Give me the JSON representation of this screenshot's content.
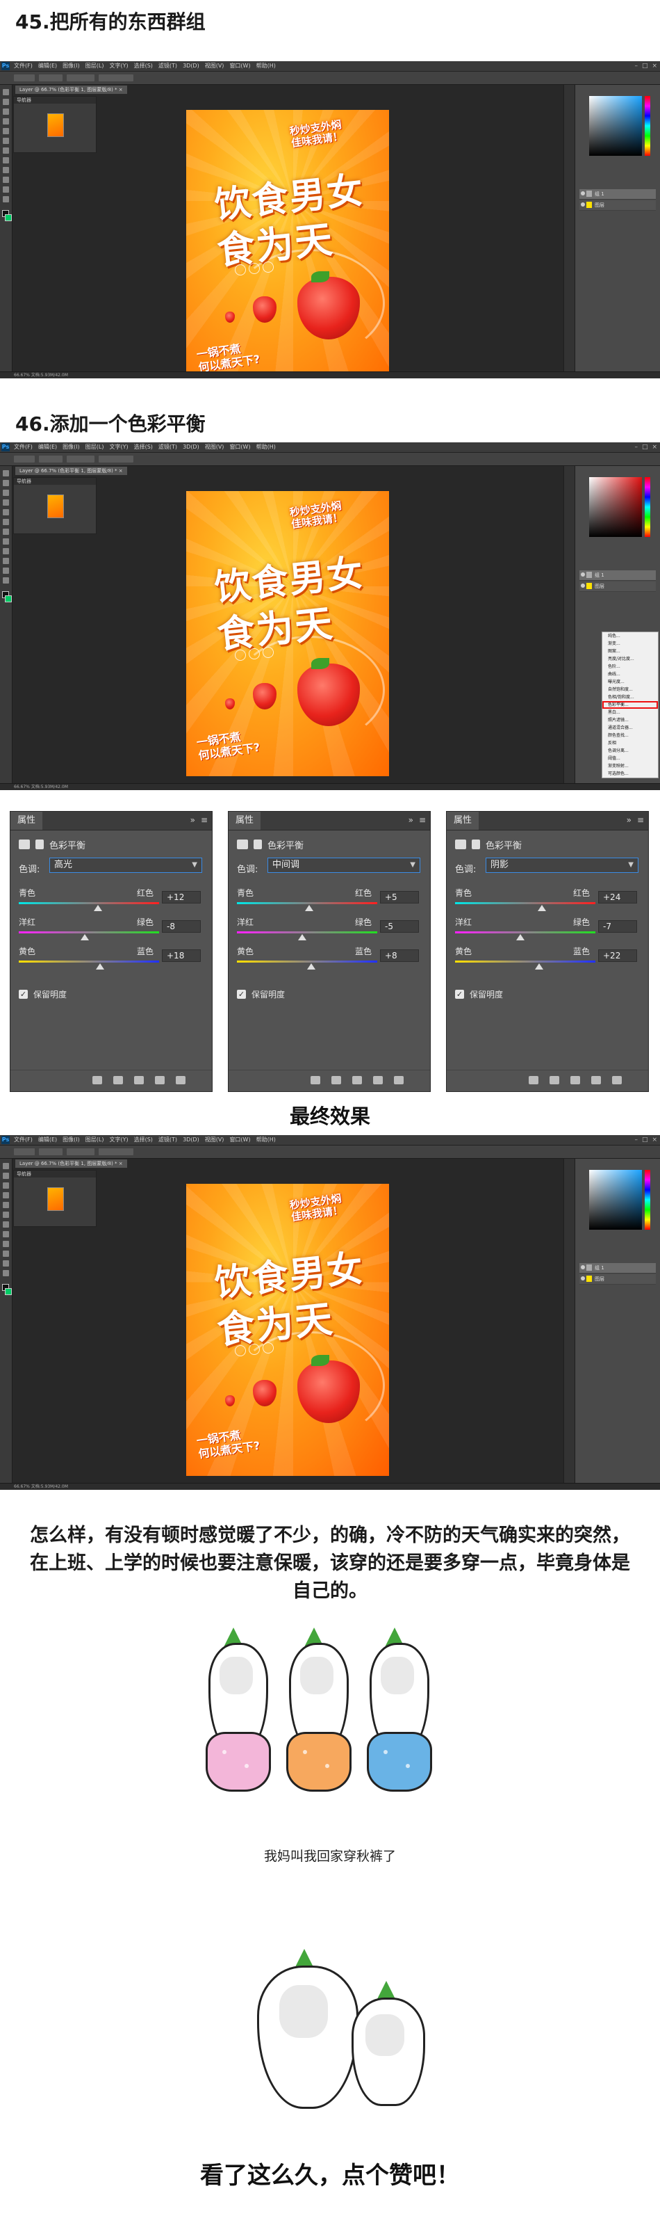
{
  "step45": {
    "title": "45.把所有的东西群组"
  },
  "step46": {
    "title": "46.添加一个色彩平衡"
  },
  "ps": {
    "menus": [
      "文件(F)",
      "编辑(E)",
      "图像(I)",
      "图层(L)",
      "文字(Y)",
      "选择(S)",
      "滤镜(T)",
      "3D(D)",
      "视图(V)",
      "窗口(W)",
      "帮助(H)"
    ],
    "doc_tab": "Layer @ 66.7% (色彩平衡 1, 图层蒙版/8) * ×",
    "nav_title": "导航器",
    "status_text": "66.67%   文档:5.93M/42.0M",
    "layers": [
      "组 1",
      "图层"
    ],
    "zoom": "66.67%"
  },
  "poster": {
    "tag_line1": "秒炒支外焖",
    "tag_line2": "佳味我请！",
    "title1": "饮食男女",
    "title2": "食为天",
    "bottom1": "一锅不煮",
    "bottom2": "何以煮天下?"
  },
  "context_menu": {
    "items": [
      "纯色...",
      "渐变...",
      "图案...",
      "亮度/对比度...",
      "色阶...",
      "曲线...",
      "曝光度...",
      "自然饱和度...",
      "色相/饱和度...",
      "色彩平衡...",
      "黑白...",
      "照片滤镜...",
      "通道混合器...",
      "颜色查找...",
      "反相",
      "色调分离...",
      "阈值...",
      "渐变映射...",
      "可选颜色..."
    ],
    "highlighted_index": 9
  },
  "properties": {
    "tab_label": "属性",
    "panel_title": "色彩平衡",
    "tone_label": "色调:",
    "slider1_left": "青色",
    "slider1_right": "红色",
    "slider2_left": "洋红",
    "slider2_right": "绿色",
    "slider3_left": "黄色",
    "slider3_right": "蓝色",
    "preserve_label": "保留明度",
    "panels": [
      {
        "tone": "高光",
        "values": [
          "+12",
          "-8",
          "+18"
        ]
      },
      {
        "tone": "中间调",
        "values": [
          "+5",
          "-5",
          "+8"
        ]
      },
      {
        "tone": "阴影",
        "values": [
          "+24",
          "-7",
          "+22"
        ]
      }
    ]
  },
  "final": {
    "title": "最终效果"
  },
  "paragraph": "怎么样，有没有顿时感觉暖了不少，的确，冷不防的天气确实来的突然，在上班、上学的时候也要注意保暖，该穿的还是要多穿一点，毕竟身体是自己的。",
  "caption": "我妈叫我回家穿秋裤了",
  "closing": "看了这么久，点个赞吧！"
}
